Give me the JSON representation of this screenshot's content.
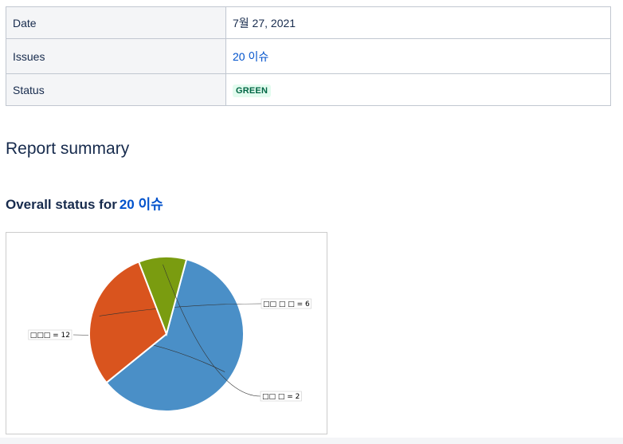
{
  "properties": {
    "date_key": "Date",
    "date_value": "7월 27, 2021",
    "issues_key": "Issues",
    "issues_value": "20 이슈",
    "status_key": "Status",
    "status_value": "GREEN"
  },
  "summary": {
    "heading": "Report summary",
    "overall_prefix": "Overall status for",
    "overall_link": "20 이슈"
  },
  "colors": {
    "link": "#0052cc",
    "status_bg": "#e3fcef",
    "status_fg": "#006644"
  },
  "chart_data": {
    "type": "pie",
    "slices": [
      {
        "label": "□□□ = 12",
        "value": 12,
        "color": "#4a8fc7"
      },
      {
        "label": "□□ □ □ = 6",
        "value": 6,
        "color": "#d9541e"
      },
      {
        "label": "□□ □ = 2",
        "value": 2,
        "color": "#7a9c10"
      }
    ]
  }
}
